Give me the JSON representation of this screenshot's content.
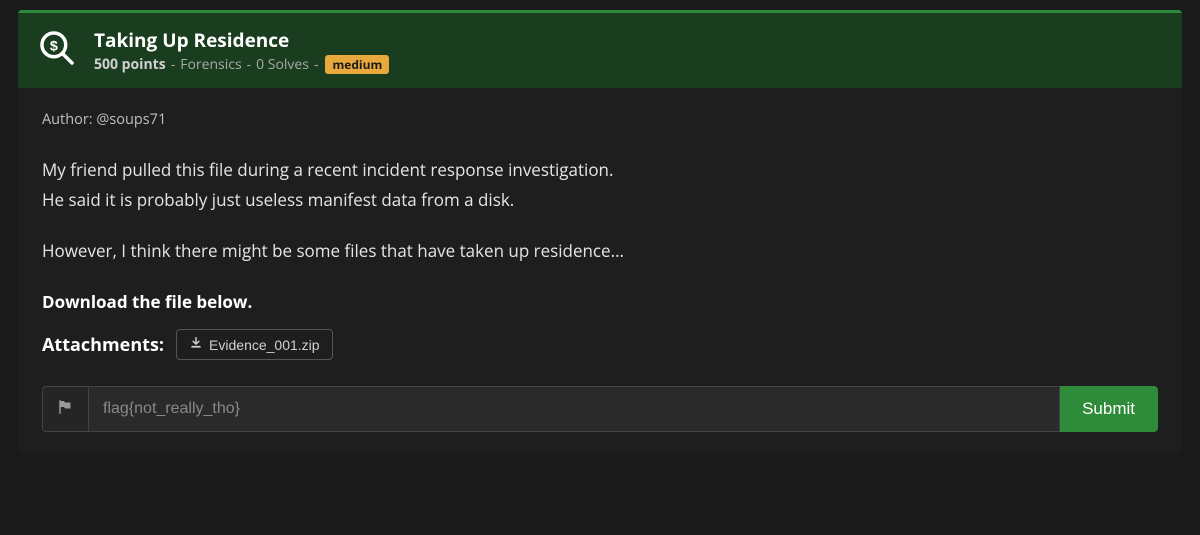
{
  "challenge": {
    "title": "Taking Up Residence",
    "points_label": "500 points",
    "category": "Forensics",
    "solves": "0 Solves",
    "difficulty": "medium",
    "author": "Author: @soups71",
    "description_line1": "My friend pulled this file during a recent incident response investigation.",
    "description_line2": "He said it is probably just useless manifest data from a disk.",
    "description_line3": "However, I think there might be some files that have taken up residence...",
    "download_label": "Download the file below.",
    "attachments_label": "Attachments:",
    "attachment_name": "Evidence_001.zip"
  },
  "form": {
    "placeholder": "flag{not_really_tho}",
    "submit_label": "Submit"
  }
}
